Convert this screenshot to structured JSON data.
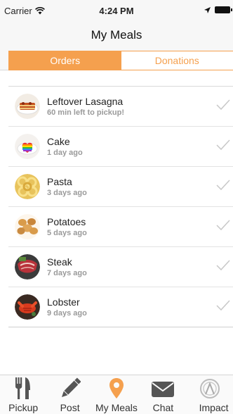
{
  "status_bar": {
    "carrier": "Carrier",
    "time": "4:24 PM"
  },
  "nav": {
    "title": "My Meals"
  },
  "segments": [
    {
      "label": "Orders",
      "active": true
    },
    {
      "label": "Donations",
      "active": false
    }
  ],
  "meals": [
    {
      "title": "Leftover Lasagna",
      "subtitle": "60 min left to pickup!",
      "food_icon": "lasagna-icon"
    },
    {
      "title": "Cake",
      "subtitle": "1 day ago",
      "food_icon": "cake-icon"
    },
    {
      "title": "Pasta",
      "subtitle": "3 days ago",
      "food_icon": "pasta-icon"
    },
    {
      "title": "Potatoes",
      "subtitle": "5 days ago",
      "food_icon": "potatoes-icon"
    },
    {
      "title": "Steak",
      "subtitle": "7 days ago",
      "food_icon": "steak-icon"
    },
    {
      "title": "Lobster",
      "subtitle": "9 days ago",
      "food_icon": "lobster-icon"
    }
  ],
  "tabs": [
    {
      "label": "Pickup",
      "icon": "fork-knife-icon",
      "active": false
    },
    {
      "label": "Post",
      "icon": "pencil-icon",
      "active": false
    },
    {
      "label": "My Meals",
      "icon": "location-pin-icon",
      "active": true
    },
    {
      "label": "Chat",
      "icon": "envelope-icon",
      "active": false
    },
    {
      "label": "Impact",
      "icon": "impact-icon",
      "active": false
    }
  ],
  "colors": {
    "accent": "#f5a04e",
    "tab_icon": "#555555",
    "check": "#c8c8c8"
  }
}
